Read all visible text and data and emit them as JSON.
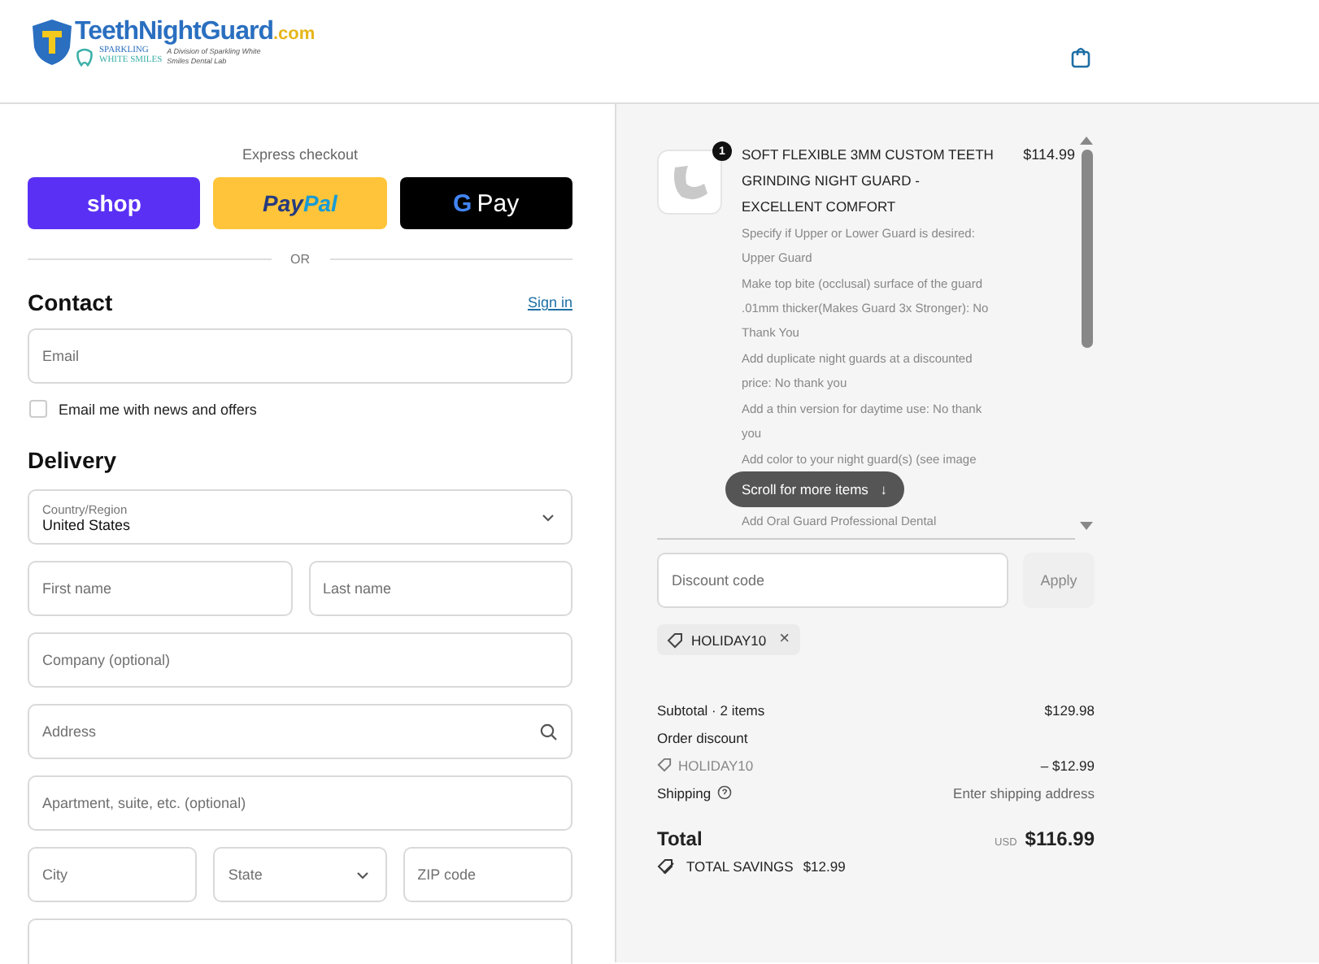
{
  "header": {
    "logo": {
      "brand": "TeethNightGuard",
      "brand_suffix": ".com",
      "sub_brand_top": "SPARKLING",
      "sub_brand_bottom": "WHITE SMILES",
      "tagline": "A Division of Sparkling White Smiles Dental Lab"
    }
  },
  "express_checkout": {
    "title": "Express checkout",
    "buttons": [
      {
        "kind": "shop",
        "label": "shop"
      },
      {
        "kind": "paypal",
        "label": "Pay",
        "label_2": "Pal"
      },
      {
        "kind": "gpay",
        "label": "G",
        "label_2": "Pay"
      }
    ],
    "divider": "OR"
  },
  "contact": {
    "title": "Contact",
    "sign_in": "Sign in",
    "email": {
      "placeholder": "Email"
    },
    "newsletter": {
      "label": "Email me with news and offers",
      "checked": false
    }
  },
  "delivery": {
    "title": "Delivery",
    "country": {
      "label": "Country/Region",
      "value": "United States"
    },
    "fields": [
      [
        {
          "kind": "text",
          "placeholder": "First name"
        },
        {
          "kind": "text",
          "placeholder": "Last name"
        }
      ],
      [
        {
          "kind": "text",
          "placeholder": "Company (optional)"
        }
      ],
      [
        {
          "kind": "search",
          "placeholder": "Address"
        }
      ],
      [
        {
          "kind": "text",
          "placeholder": "Apartment, suite, etc. (optional)"
        }
      ],
      [
        {
          "kind": "text",
          "placeholder": "City"
        },
        {
          "kind": "select",
          "placeholder": "State"
        },
        {
          "kind": "text",
          "placeholder": "ZIP code"
        }
      ],
      [
        {
          "kind": "text"
        }
      ]
    ]
  },
  "order": {
    "items": [
      {
        "quantity": "1",
        "title": "SOFT FLEXIBLE 3MM CUSTOM TEETH GRINDING NIGHT GUARD - EXCELLENT COMFORT",
        "price": "$114.99",
        "options": [
          "Specify if Upper or Lower Guard is desired: Upper Guard",
          "Make top bite (occlusal) surface of the guard .01mm thicker(Makes Guard 3x Stronger): No Thank You",
          "Add duplicate night guards at a discounted price: No thank you",
          "Add a thin version for daytime use: No thank you",
          "Add color to your night guard(s) (see image",
          "Add Oral Guard Professional Dental"
        ]
      }
    ],
    "scroll_hint": "Scroll for more items",
    "scroll_hint_arrow": "↓",
    "discount": {
      "placeholder": "Discount code",
      "apply": "Apply",
      "applied_code": "HOLIDAY10",
      "remove": "×"
    },
    "summary": {
      "subtotal_label": "Subtotal · 2 items",
      "subtotal": "$129.98",
      "discount_label": "Order discount",
      "discount_code": "HOLIDAY10",
      "discount_amount": "– $12.99",
      "shipping_label": "Shipping",
      "shipping_value": "Enter shipping address",
      "total_label": "Total",
      "currency": "USD",
      "total": "$116.99",
      "savings_label": "TOTAL SAVINGS",
      "savings": "$12.99"
    }
  }
}
